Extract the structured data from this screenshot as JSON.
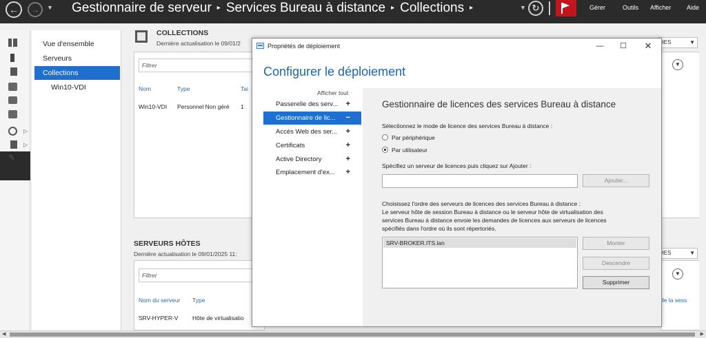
{
  "titlebar": {
    "breadcrumb": [
      "Gestionnaire de serveur",
      "Services Bureau à distance",
      "Collections"
    ],
    "separator": "▸",
    "menus": [
      "Gérer",
      "Outils",
      "Afficher",
      "Aide"
    ]
  },
  "nav": {
    "items": [
      "Vue d'ensemble",
      "Serveurs",
      "Collections",
      "Win10-VDI"
    ]
  },
  "collections": {
    "title": "COLLECTIONS",
    "subtitle": "Dernière actualisation le 09/01/2",
    "filter_placeholder": "Filtrer",
    "columns": [
      "Nom",
      "Type",
      "Tai"
    ],
    "rows": [
      [
        "Win10-VDI",
        "Personnel Non géré",
        "1"
      ]
    ],
    "right_ctl": "HES"
  },
  "hosts": {
    "title": "SERVEURS HÔTES",
    "subtitle": "Dernière actualisation le 09/01/2025 11:",
    "filter_placeholder": "Filtrer",
    "columns": [
      "Nom du serveur",
      "Type"
    ],
    "rows": [
      [
        "SRV-HYPER-V",
        "Hôte de virtualisatio"
      ]
    ],
    "right_ctl": "HES",
    "right_col": "de la sess"
  },
  "dialog": {
    "title": "Propriétés de déploiement",
    "heading": "Configurer le déploiement",
    "show_all": "Afficher tout",
    "nav": [
      {
        "label": "Passerelle des serv...",
        "sign": "+"
      },
      {
        "label": "Gestionnaire de lic...",
        "sign": "−"
      },
      {
        "label": "Accès Web des ser...",
        "sign": "+"
      },
      {
        "label": "Certificats",
        "sign": "+"
      },
      {
        "label": "Active Directory",
        "sign": "+"
      },
      {
        "label": "Emplacement d'ex...",
        "sign": "+"
      }
    ],
    "content": {
      "heading": "Gestionnaire de licences des services Bureau à distance",
      "mode_label": "Sélectionnez le mode de licence des services Bureau à distance :",
      "radio_device": "Par périphérique",
      "radio_user": "Par utilisateur",
      "server_label": "Spécifiez un serveur de licences puis cliquez sur Ajouter :",
      "add_button": "Ajouter...",
      "order_label": "Choisissez l'ordre des serveurs de licences des services Bureau à distance :",
      "order_desc_1": "Le serveur hôte de session Bureau à distance ou le serveur hôte de virtualisation des",
      "order_desc_2": "services Bureau à distance envoie les demandes de licences aux serveurs de licences",
      "order_desc_3": "spécifiés dans l'ordre où ils sont répertoriés.",
      "servers": [
        "SRV-BROKER.ITS.lan"
      ],
      "up_button": "Monter",
      "down_button": "Descendre",
      "delete_button": "Supprimer"
    }
  }
}
